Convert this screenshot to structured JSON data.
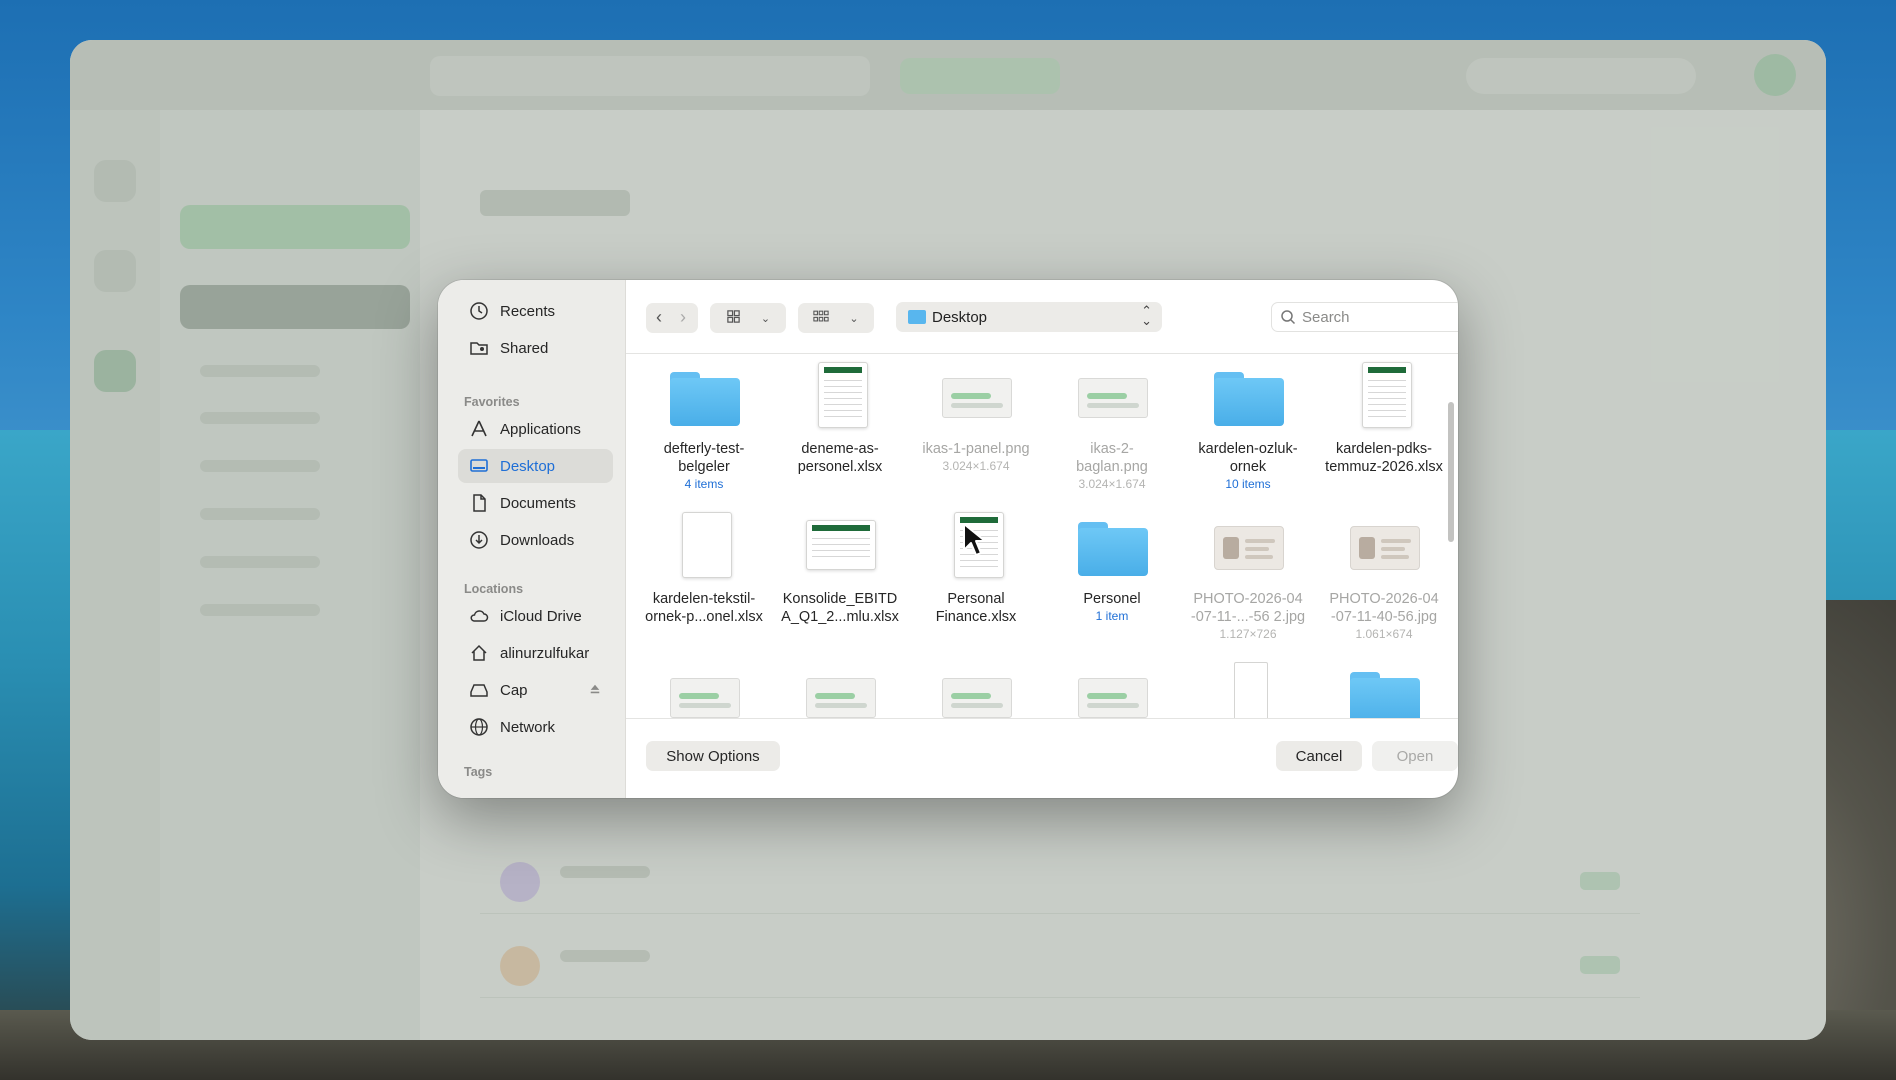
{
  "window": {
    "title": "Desktop"
  },
  "sidebar": {
    "top_items": [
      {
        "label": "Recents",
        "icon": "clock-icon"
      },
      {
        "label": "Shared",
        "icon": "shared-folder-icon"
      }
    ],
    "favorites_label": "Favorites",
    "favorites": [
      {
        "label": "Applications",
        "icon": "applications-icon"
      },
      {
        "label": "Desktop",
        "icon": "desktop-icon",
        "selected": true
      },
      {
        "label": "Documents",
        "icon": "document-icon"
      },
      {
        "label": "Downloads",
        "icon": "download-icon"
      }
    ],
    "locations_label": "Locations",
    "locations": [
      {
        "label": "iCloud Drive",
        "icon": "cloud-icon"
      },
      {
        "label": "alinurzulfukar",
        "icon": "home-icon"
      },
      {
        "label": "Cap",
        "icon": "drive-icon",
        "ejectable": true
      },
      {
        "label": "Network",
        "icon": "globe-icon"
      }
    ],
    "tags_label": "Tags"
  },
  "toolbar": {
    "back_icon": "chevron-left-icon",
    "forward_icon": "chevron-right-icon",
    "view_icon": "icon-grid-icon",
    "group_icon": "group-grid-icon",
    "location": "Desktop",
    "search_placeholder": "Search"
  },
  "files": [
    {
      "name_l1": "defterly-test-",
      "name_l2": "belgeler",
      "sub": "4 items",
      "kind": "folder",
      "dim": false
    },
    {
      "name_l1": "deneme-as-",
      "name_l2": "personel.xlsx",
      "sub": "",
      "kind": "sheet",
      "dim": false
    },
    {
      "name_l1": "ikas-1-panel.png",
      "name_l2": "",
      "sub": "3.024×1.674",
      "kind": "image",
      "dim": true
    },
    {
      "name_l1": "ikas-2-",
      "name_l2": "baglan.png",
      "sub": "3.024×1.674",
      "kind": "image",
      "dim": true
    },
    {
      "name_l1": "kardelen-ozluk-",
      "name_l2": "ornek",
      "sub": "10 items",
      "kind": "folder",
      "dim": false
    },
    {
      "name_l1": "kardelen-pdks-",
      "name_l2": "temmuz-2026.xlsx",
      "sub": "",
      "kind": "sheet",
      "dim": false
    },
    {
      "name_l1": "kardelen-tekstil-",
      "name_l2": "ornek-p...onel.xlsx",
      "sub": "",
      "kind": "sheet-blank",
      "dim": false
    },
    {
      "name_l1": "Konsolide_EBITD",
      "name_l2": "A_Q1_2...mlu.xlsx",
      "sub": "",
      "kind": "sheet-wide",
      "dim": false
    },
    {
      "name_l1": "Personal",
      "name_l2": "Finance.xlsx",
      "sub": "",
      "kind": "sheet",
      "dim": false
    },
    {
      "name_l1": "Personel",
      "name_l2": "",
      "sub": "1 item",
      "kind": "folder",
      "dim": false
    },
    {
      "name_l1": "PHOTO-2026-04",
      "name_l2": "-07-11-...-56 2.jpg",
      "sub": "1.127×726",
      "kind": "idcard",
      "dim": true
    },
    {
      "name_l1": "PHOTO-2026-04",
      "name_l2": "-07-11-40-56.jpg",
      "sub": "1.061×674",
      "kind": "idcard",
      "dim": true
    },
    {
      "name_l1": "",
      "name_l2": "",
      "sub": "",
      "kind": "image",
      "dim": true
    },
    {
      "name_l1": "",
      "name_l2": "",
      "sub": "",
      "kind": "image",
      "dim": true
    },
    {
      "name_l1": "",
      "name_l2": "",
      "sub": "",
      "kind": "image",
      "dim": true
    },
    {
      "name_l1": "",
      "name_l2": "",
      "sub": "",
      "kind": "image",
      "dim": true
    },
    {
      "name_l1": "",
      "name_l2": "",
      "sub": "",
      "kind": "tall",
      "dim": true
    },
    {
      "name_l1": "",
      "name_l2": "",
      "sub": "",
      "kind": "folder",
      "dim": false
    }
  ],
  "footer": {
    "show_options": "Show Options",
    "cancel": "Cancel",
    "open": "Open"
  },
  "colors": {
    "accent": "#1f6fd6",
    "folder": "#5bbcf0"
  }
}
